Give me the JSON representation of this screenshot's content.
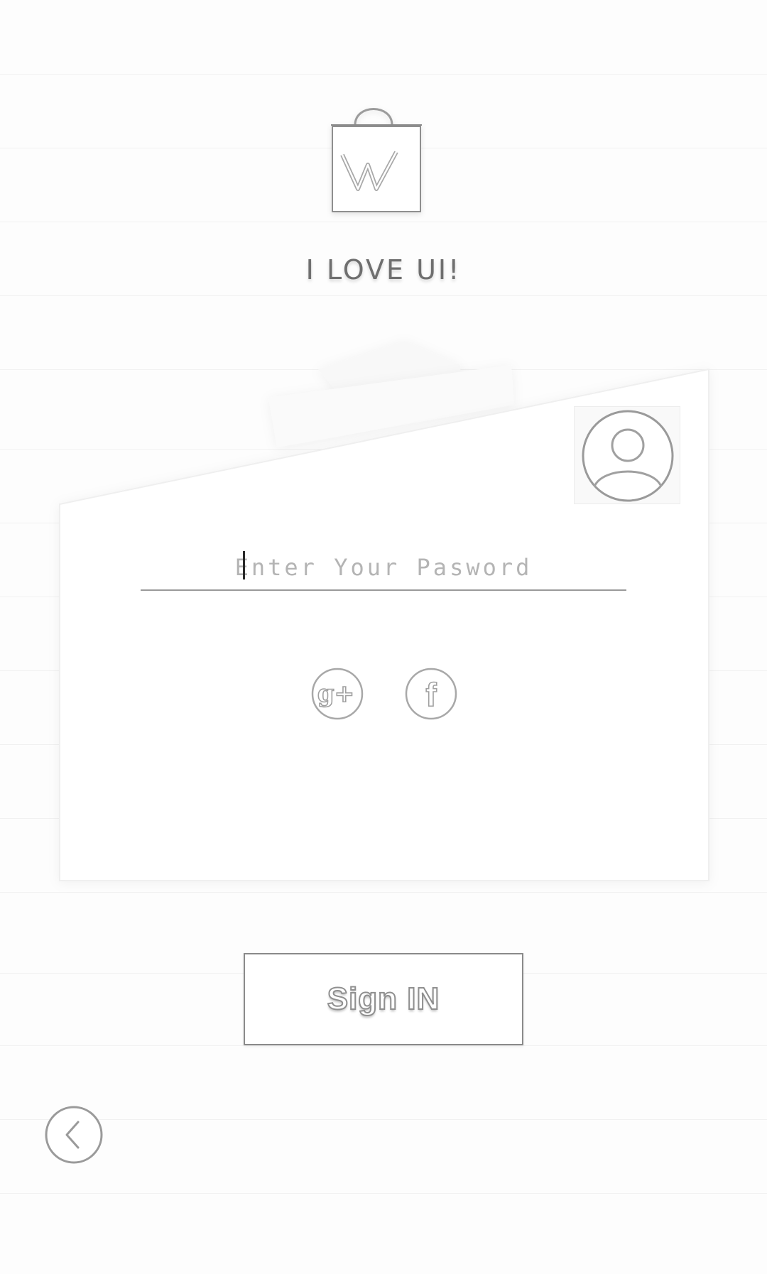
{
  "app": {
    "title": "I LOVE UI!",
    "logo_letter": "W"
  },
  "login": {
    "password_placeholder": "Enter Your Pasword",
    "password_value": "",
    "sign_in_label": "Sign IN"
  },
  "social": [
    {
      "name": "google-plus",
      "icon": "google-plus-icon",
      "glyph": "g+"
    },
    {
      "name": "facebook",
      "icon": "facebook-icon",
      "glyph": "f"
    }
  ],
  "icons": {
    "logo": "shopping-bag-w-icon",
    "avatar": "user-avatar-icon",
    "back": "chevron-left-icon"
  },
  "colors": {
    "background": "#fdfdfd",
    "line": "#9a9a9a",
    "text_muted": "#6f6f6f"
  }
}
